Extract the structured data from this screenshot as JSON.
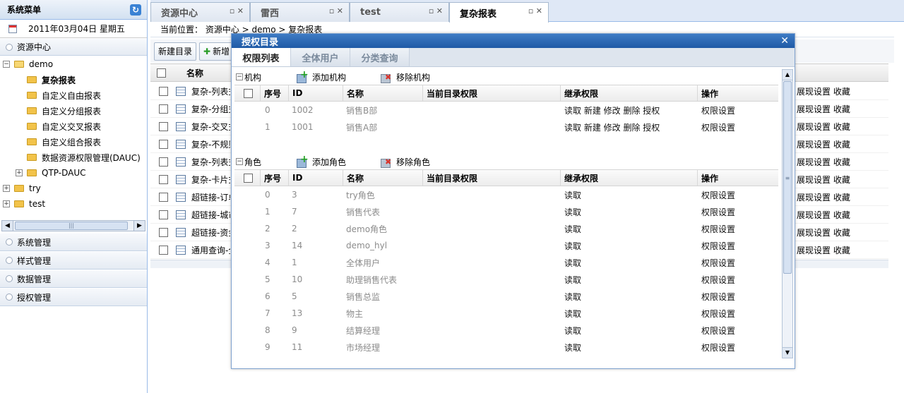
{
  "sidebar": {
    "title": "系统菜单",
    "date": "2011年03月04日 星期五",
    "resource_panel": "资源中心",
    "tree": [
      {
        "label": "demo",
        "toggle": "−",
        "kind": "open",
        "indent": 0
      },
      {
        "label": "复杂报表",
        "toggle": "",
        "kind": "folder",
        "indent": 1,
        "selected": true
      },
      {
        "label": "自定义自由报表",
        "toggle": "",
        "kind": "folder",
        "indent": 1
      },
      {
        "label": "自定义分组报表",
        "toggle": "",
        "kind": "folder",
        "indent": 1
      },
      {
        "label": "自定义交叉报表",
        "toggle": "",
        "kind": "folder",
        "indent": 1
      },
      {
        "label": "自定义组合报表",
        "toggle": "",
        "kind": "folder",
        "indent": 1
      },
      {
        "label": "数据资源权限管理(DAUC)",
        "toggle": "",
        "kind": "folder",
        "indent": 1
      },
      {
        "label": "QTP-DAUC",
        "toggle": "+",
        "kind": "folder",
        "indent": 1
      },
      {
        "label": "try",
        "toggle": "+",
        "kind": "folder",
        "indent": 0
      },
      {
        "label": "test",
        "toggle": "+",
        "kind": "folder",
        "indent": 0
      }
    ],
    "bottom_panels": [
      "系统管理",
      "样式管理",
      "数据管理",
      "授权管理"
    ]
  },
  "tabs": [
    {
      "label": "资源中心",
      "active": false,
      "ctl": "▫ ✕"
    },
    {
      "label": "雷西",
      "active": false,
      "ctl": "▫ ✕"
    },
    {
      "label": "test",
      "active": false,
      "ctl": "▫ ✕"
    },
    {
      "label": "复杂报表",
      "active": true,
      "ctl": "▫ ✕"
    }
  ],
  "breadcrumb": "当前位置： 资源中心 > demo > 复杂报表",
  "toolbar": {
    "new_dir": "新建目录",
    "new_item": "新增"
  },
  "grid": {
    "col_name": "名称",
    "rows": [
      {
        "name": "复杂-列表式",
        "ops": "展现设置  收藏"
      },
      {
        "name": "复杂-分组式",
        "ops": "展现设置  收藏"
      },
      {
        "name": "复杂-交叉式",
        "ops": "展现设置  收藏"
      },
      {
        "name": "复杂-不规则",
        "ops": "展现设置  收藏"
      },
      {
        "name": "复杂-列表式",
        "ops": "展现设置  收藏"
      },
      {
        "name": "复杂-卡片式",
        "ops": "展现设置  收藏"
      },
      {
        "name": "超链接-订单",
        "ops": "展现设置  收藏"
      },
      {
        "name": "超链接-城市",
        "ops": "展现设置  收藏"
      },
      {
        "name": "超链接-资金",
        "ops": "展现设置  收藏"
      },
      {
        "name": "通用查询-全",
        "ops": "展现设置  收藏"
      }
    ]
  },
  "dialog": {
    "title": "授权目录",
    "close": "✕",
    "tabs": [
      "权限列表",
      "全体用户",
      "分类查询"
    ],
    "columns": [
      "序号",
      "ID",
      "名称",
      "当前目录权限",
      "继承权限",
      "操作"
    ],
    "org": {
      "title": "机构",
      "add": "添加机构",
      "remove": "移除机构",
      "rows": [
        {
          "idx": "0",
          "id": "1002",
          "name": "销售B部",
          "cur": "",
          "inherit": "读取 新建 修改 删除 授权",
          "op": "权限设置"
        },
        {
          "idx": "1",
          "id": "1001",
          "name": "销售A部",
          "cur": "",
          "inherit": "读取 新建 修改 删除 授权",
          "op": "权限设置"
        }
      ]
    },
    "role": {
      "title": "角色",
      "add": "添加角色",
      "remove": "移除角色",
      "rows": [
        {
          "idx": "0",
          "id": "3",
          "name": "try角色",
          "cur": "",
          "inherit": "读取",
          "op": "权限设置"
        },
        {
          "idx": "1",
          "id": "7",
          "name": "销售代表",
          "cur": "",
          "inherit": "读取",
          "op": "权限设置"
        },
        {
          "idx": "2",
          "id": "2",
          "name": "demo角色",
          "cur": "",
          "inherit": "读取",
          "op": "权限设置"
        },
        {
          "idx": "3",
          "id": "14",
          "name": "demo_hyl",
          "cur": "",
          "inherit": "读取",
          "op": "权限设置"
        },
        {
          "idx": "4",
          "id": "1",
          "name": "全体用户",
          "cur": "",
          "inherit": "读取",
          "op": "权限设置"
        },
        {
          "idx": "5",
          "id": "10",
          "name": "助理销售代表",
          "cur": "",
          "inherit": "读取",
          "op": "权限设置"
        },
        {
          "idx": "6",
          "id": "5",
          "name": "销售总监",
          "cur": "",
          "inherit": "读取",
          "op": "权限设置"
        },
        {
          "idx": "7",
          "id": "13",
          "name": "物主",
          "cur": "",
          "inherit": "读取",
          "op": "权限设置"
        },
        {
          "idx": "8",
          "id": "9",
          "name": "结算经理",
          "cur": "",
          "inherit": "读取",
          "op": "权限设置"
        },
        {
          "idx": "9",
          "id": "11",
          "name": "市场经理",
          "cur": "",
          "inherit": "读取",
          "op": "权限设置"
        }
      ]
    }
  }
}
